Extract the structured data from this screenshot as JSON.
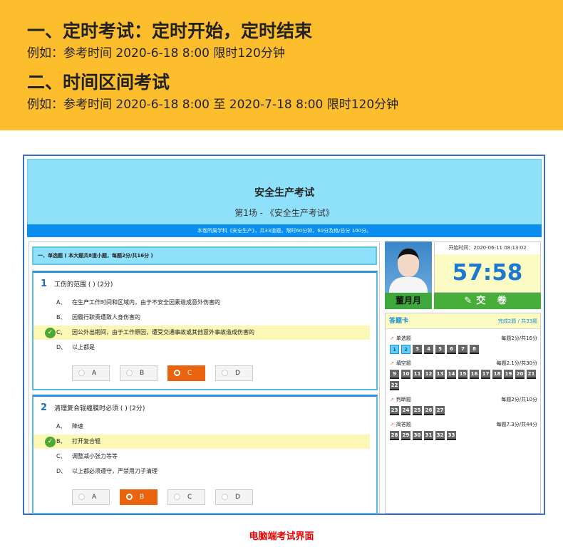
{
  "promo": {
    "title1": "一、定时考试：定时开始，定时结束",
    "sub1": "例如：参考时间 2020-6-18 8:00  限时120分钟",
    "title2": "二、时间区间考试",
    "sub2": "例如：参考时间 2020-6-18 8:00 至 2020-7-18 8:00 限时120分钟"
  },
  "exam": {
    "title": "安全生产考试",
    "session": "第1场 - 《安全生产考试》",
    "info": "本卷所属学科《安全生产》，共33道题，限时60分钟，60分及格/总分 100分。",
    "section": "一、单选题 ( 本大题共8道小题，每题2分/共16分 )"
  },
  "questions": [
    {
      "num": "1",
      "text": "工伤的范围 (   ) (2分)",
      "options": [
        {
          "letter": "A、",
          "text": "在生产工作时间和区域内，由于不安全因素造成意外伤害的"
        },
        {
          "letter": "B、",
          "text": "因履行职责遭致人身伤害的"
        },
        {
          "letter": "C、",
          "text": "因公外出期间，由于工作原因，遭受交通事故或其他意外事故造成伤害的"
        },
        {
          "letter": "D、",
          "text": "以上都是"
        }
      ],
      "buttons": [
        "A",
        "B",
        "C",
        "D"
      ],
      "selected": "C"
    },
    {
      "num": "2",
      "text": "清理复合辊缠膜时必须 (   ) (2分)",
      "options": [
        {
          "letter": "A、",
          "text": "降速"
        },
        {
          "letter": "B、",
          "text": "打开复合辊"
        },
        {
          "letter": "C、",
          "text": "调整减小张力等等"
        },
        {
          "letter": "D、",
          "text": "以上都必须遵守，严禁用刀子清理"
        }
      ],
      "buttons": [
        "A",
        "B",
        "C",
        "D"
      ],
      "selected": "B"
    }
  ],
  "candidate": {
    "name": "董月月",
    "start_time": "开始时间：2020-06-11 08:13:02",
    "countdown": "57:58",
    "submit": "交  卷"
  },
  "answer_card": {
    "title": "答题卡",
    "progress": "完成2题 / 共33题",
    "groups": [
      {
        "name": "单选题",
        "score": "每题2分/共16分",
        "nums": [
          "1",
          "2",
          "3",
          "4",
          "5",
          "6",
          "7",
          "8"
        ],
        "done": [
          "1",
          "2"
        ]
      },
      {
        "name": "填空题",
        "score": "每题2.1分/共30分",
        "nums": [
          "9",
          "10",
          "11",
          "12",
          "13",
          "14",
          "15",
          "16",
          "17",
          "18",
          "19",
          "20",
          "21",
          "22"
        ],
        "done": []
      },
      {
        "name": "判断题",
        "score": "每题2分/共10分",
        "nums": [
          "23",
          "24",
          "25",
          "26",
          "27"
        ],
        "done": []
      },
      {
        "name": "简答题",
        "score": "每题7.3分/共44分",
        "nums": [
          "28",
          "29",
          "30",
          "31",
          "32",
          "33"
        ],
        "done": []
      }
    ]
  },
  "caption": "电脑端考试界面"
}
